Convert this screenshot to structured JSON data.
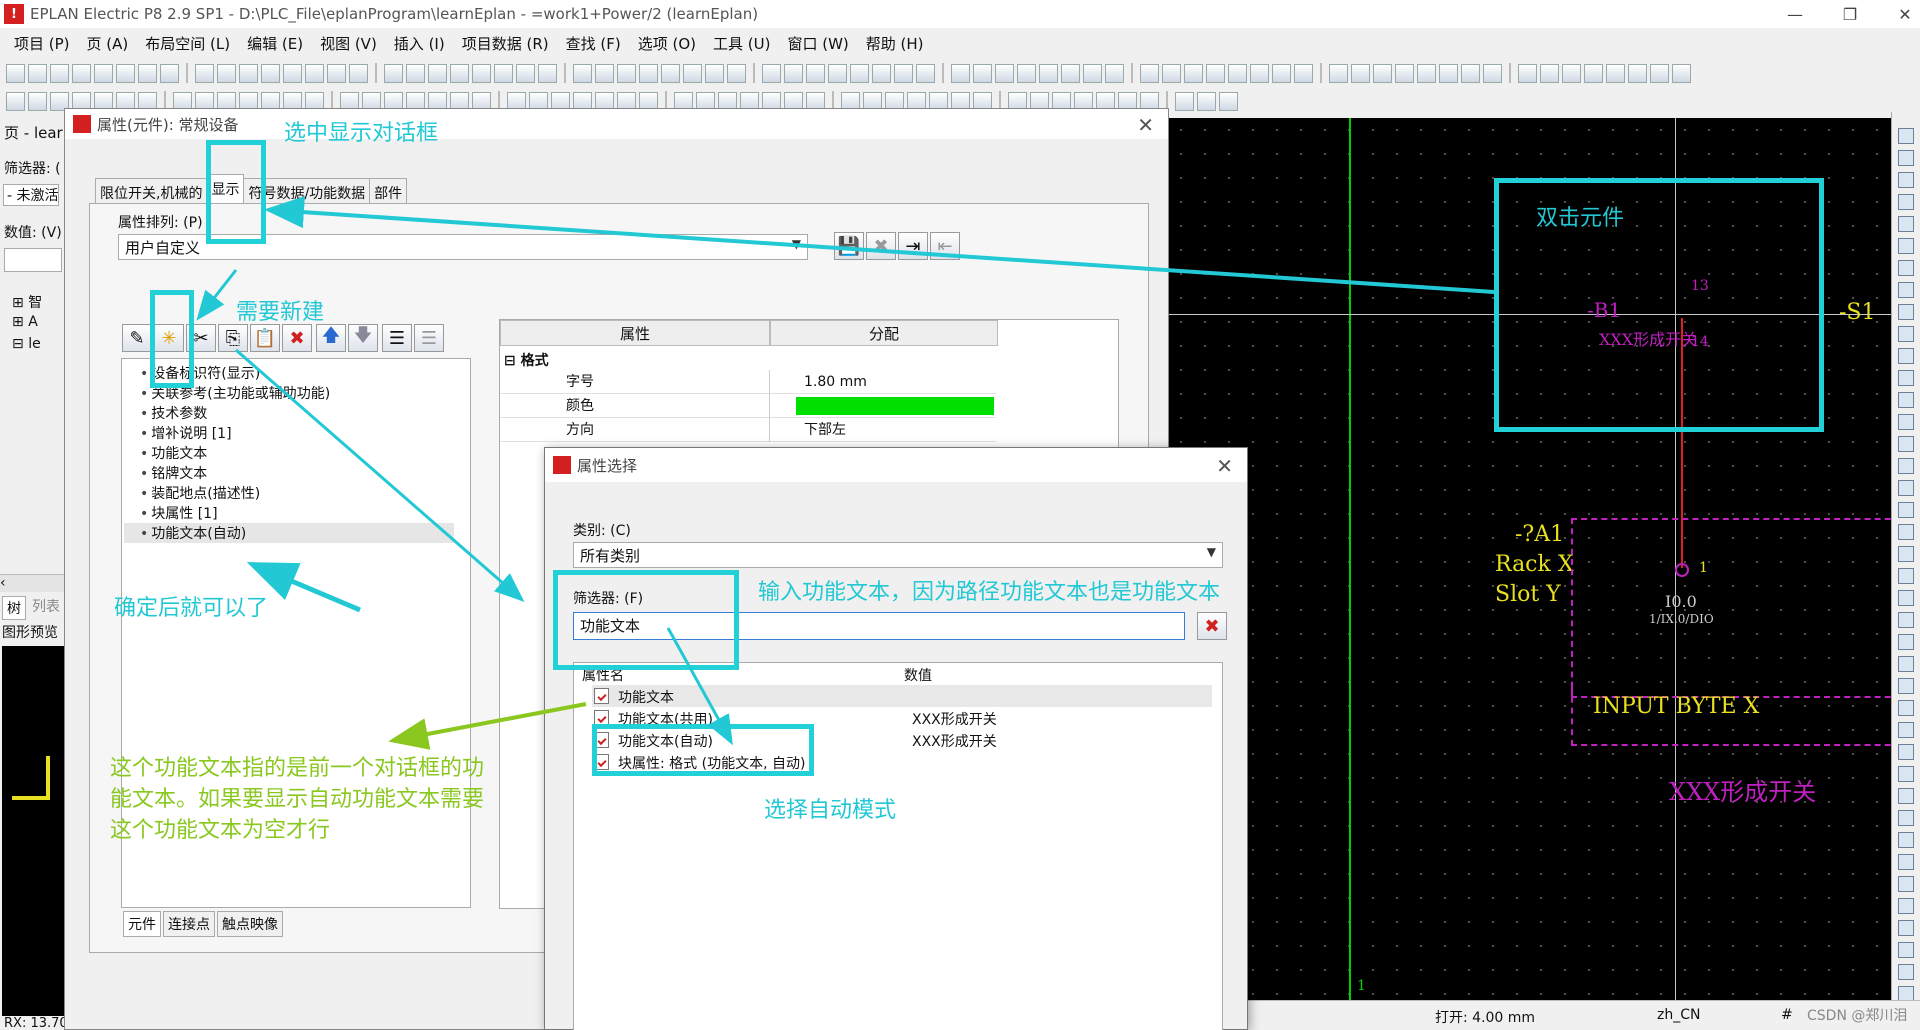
{
  "window": {
    "title": "EPLAN Electric P8 2.9 SP1 - D:\\PLC_File\\eplanProgram\\learnEplan - =work1+Power/2 (learnEplan)",
    "minimize": "—",
    "restore": "❐",
    "close": "✕"
  },
  "menu": [
    "项目 (P)",
    "页 (A)",
    "布局空间 (L)",
    "编辑 (E)",
    "视图 (V)",
    "插入 (I)",
    "项目数据 (R)",
    "查找 (F)",
    "选项 (O)",
    "工具 (U)",
    "窗口 (W)",
    "帮助 (H)"
  ],
  "left_panel": {
    "header": "页 - lear",
    "filter_label": "筛选器: (",
    "filter_value": "- 未激活",
    "value_label": "数值: (V)",
    "tree_items": [
      "智",
      "A",
      "le"
    ],
    "tab_tree": "树",
    "tab_list": "列表",
    "preview": "图形预览",
    "coords": "RX: 13.70"
  },
  "main_dialog": {
    "title": "属性(元件): 常规设备",
    "close": "✕",
    "tabs": [
      "限位开关,机械的",
      "显示",
      "符号数据/功能数据",
      "部件"
    ],
    "attr_order_label": "属性排列: (P)",
    "attr_order_value": "用户自定义",
    "tree": [
      "设备标识符(显示)",
      "关联参考(主功能或辅助功能)",
      "技术参数",
      "增补说明 [1]",
      "功能文本",
      "铭牌文本",
      "装配地点(描述性)",
      "块属性 [1]",
      "功能文本(自动)"
    ],
    "grid_head_property": "属性",
    "grid_head_assignment": "分配",
    "grid_group": "格式",
    "grid_rows": [
      {
        "k": "字号",
        "v": "1.80 mm"
      },
      {
        "k": "颜色",
        "v": ""
      },
      {
        "k": "方向",
        "v": "下部左"
      }
    ],
    "color_value": "#00e000",
    "bottom_tabs": [
      "元件",
      "连接点",
      "触点映像"
    ]
  },
  "select_dialog": {
    "title": "属性选择",
    "close": "✕",
    "category_label": "类别: (C)",
    "category_value": "所有类别",
    "filter_label": "筛选器: (F)",
    "filter_value": "功能文本",
    "col_name": "属性名",
    "col_value": "数值",
    "rows": [
      {
        "n": "功能文本",
        "v": ""
      },
      {
        "n": "功能文本(共用)",
        "v": "XXX形成开关"
      },
      {
        "n": "功能文本(自动)",
        "v": "XXX形成开关"
      },
      {
        "n": "块属性: 格式 (功能文本, 自动)",
        "v": ""
      }
    ]
  },
  "canvas": {
    "b1_label": "-B1",
    "pin13": "13",
    "pin14": "14",
    "s1_label": "-S1",
    "b1_func": "XXX形成开关",
    "a1": "-?A1",
    "rack": "Rack X",
    "slot": "Slot Y",
    "pin1": "1",
    "io_addr": "I0.0",
    "io_sub": "1/IX.0/DIO",
    "input_byte": "INPUT BYTE X",
    "func_text_big": "XXX形成开关",
    "bottom_num": "1"
  },
  "status": {
    "open": "打开: 4.00 mm",
    "lang": "zh_CN",
    "hash": "#",
    "watermark": "CSDN @郑川泪"
  },
  "annotations": {
    "select_display": "选中显示对话框",
    "double_click": "双击元件",
    "need_new": "需要新建",
    "confirm_ok": "确定后就可以了",
    "input_func": "输入功能文本，因为路径功能文本也是功能文本",
    "choose_auto": "选择自动模式",
    "green_note": "这个功能文本指的是前一个对话框的功能文本。如果要显示自动功能文本需要这个功能文本为空才行"
  },
  "colors": {
    "annotation": "#22c8d4",
    "annotation_green": "#8ac820",
    "cad_magenta": "#c020c0",
    "cad_yellow": "#e8e020",
    "cad_green": "#00d000"
  }
}
